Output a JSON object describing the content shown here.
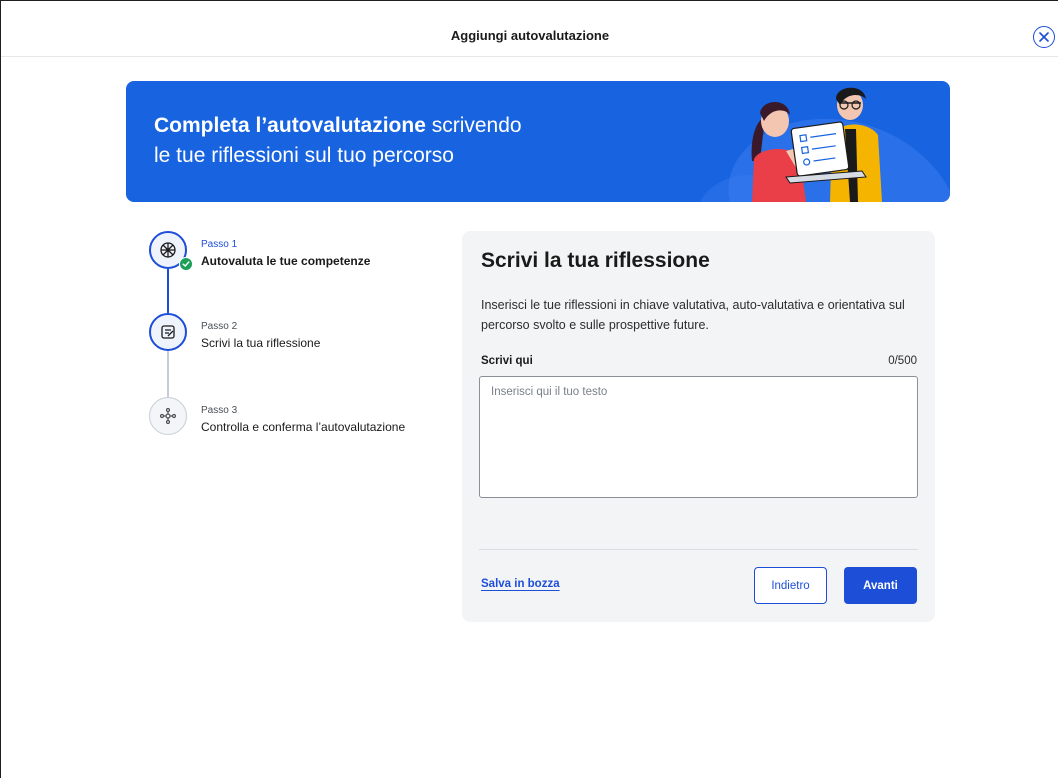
{
  "header": {
    "title": "Aggiungi autovalutazione",
    "close_icon": "close-circle-icon"
  },
  "banner": {
    "title_bold": "Completa l’autovalutazione",
    "title_rest": " scrivendo",
    "title_line2": "le tue riflessioni sul tuo percorso",
    "illustration": "two-people-reviewing-laptop-illustration"
  },
  "steps": [
    {
      "number_label": "Passo 1",
      "label": "Autovaluta le tue competenze",
      "status": "completed",
      "icon": "compass-icon"
    },
    {
      "number_label": "Passo 2",
      "label": "Scrivi la tua riflessione",
      "status": "current",
      "icon": "edit-note-icon"
    },
    {
      "number_label": "Passo 3",
      "label": "Controlla e conferma l’autovalutazione",
      "status": "pending",
      "icon": "network-icon"
    }
  ],
  "form": {
    "title": "Scrivi la tua riflessione",
    "description": "Inserisci le tue riflessioni in chiave valutativa, auto-valutativa e orientativa sul percorso svolto e sulle prospettive future.",
    "field_label": "Scrivi qui",
    "counter": "0/500",
    "value": "",
    "placeholder": "Inserisci qui il tuo testo",
    "save_draft_label": "Salva in bozza",
    "back_label": "Indietro",
    "next_label": "Avanti"
  },
  "colors": {
    "primary": "#1d4ed8",
    "banner": "#1763e0",
    "success": "#1a9e58",
    "card_bg": "#f3f4f6"
  }
}
